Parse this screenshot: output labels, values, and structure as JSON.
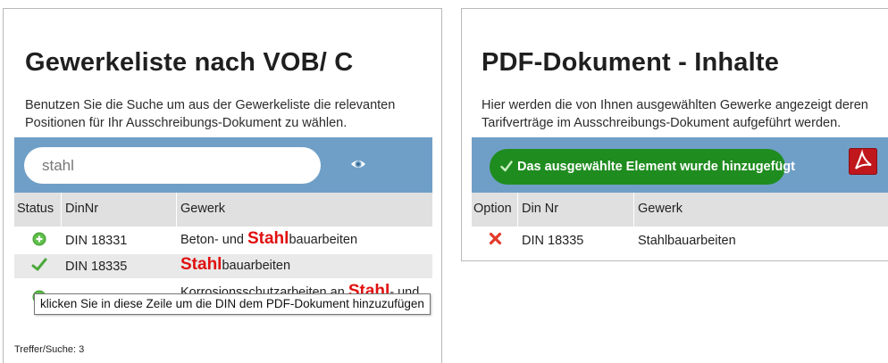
{
  "left": {
    "title": "Gewerkeliste nach VOB/ C",
    "intro_line1": "Benutzen Sie die Suche um aus der Gewerkeliste die relevanten",
    "intro_line2": "Positionen für Ihr Ausschreibungs-Dokument zu wählen.",
    "search": {
      "value": "stahl",
      "icon": "eye-icon"
    },
    "columns": [
      "Status",
      "DinNr",
      "Gewerk"
    ],
    "rows": [
      {
        "status_icon": "add-circle-icon",
        "din": "DIN 18331",
        "gewerk_pre": "Beton- und ",
        "gewerk_hl": "Stahl",
        "gewerk_post": "bauarbeiten"
      },
      {
        "status_icon": "checkmark-icon",
        "din": "DIN 18335",
        "gewerk_pre": "",
        "gewerk_hl": "Stahl",
        "gewerk_post": "bauarbeiten"
      },
      {
        "status_icon": "add-circle-icon",
        "din": "",
        "gewerk_pre": "Korrosionsschutzarbeiten an ",
        "gewerk_hl": "Stahl",
        "gewerk_post": "- und"
      }
    ],
    "tooltip": "klicken Sie in diese Zeile um die DIN dem PDF-Dokument hinzuzufügen",
    "footer": "Treffer/Suche: 3"
  },
  "right": {
    "title": "PDF-Dokument - Inhalte",
    "intro_line1": "Hier werden die von Ihnen ausgewählten Gewerke angezeigt deren",
    "intro_line2": "Tarifverträge im Ausschreibungs-Dokument aufgeführt werden.",
    "success_message": "Das ausgewählte Element wurde hinzugefügt",
    "pdf_icon": "pdf-icon",
    "columns": [
      "Option",
      "Din Nr",
      "Gewerk"
    ],
    "rows": [
      {
        "option_icon": "remove-x-icon",
        "din": "DIN 18335",
        "gewerk": "Stahlbauarbeiten"
      }
    ]
  },
  "colors": {
    "accent_bar": "#6f9fc7",
    "success": "#1f8c1f",
    "highlight": "#e01010",
    "pdf_red": "#c0171d"
  }
}
